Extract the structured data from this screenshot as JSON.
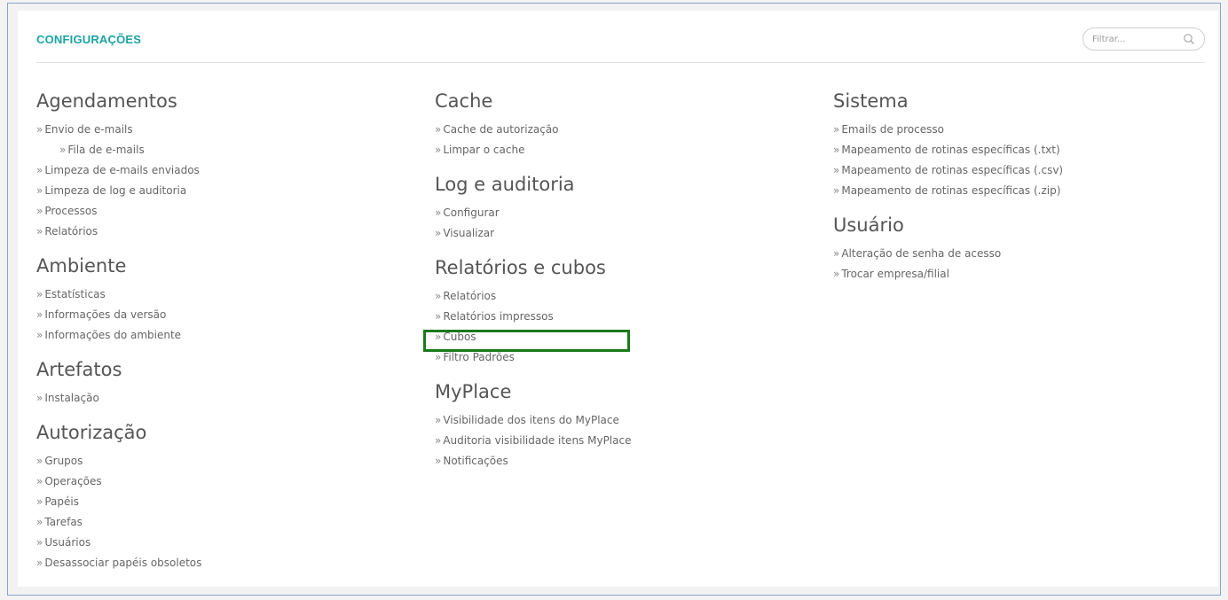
{
  "header": {
    "title": "CONFIGURAÇÕES",
    "filter_placeholder": "Filtrar...",
    "filter_value": ""
  },
  "chevron": "»",
  "columns": [
    {
      "sections": [
        {
          "title": "Agendamentos",
          "links": [
            {
              "label": "Envio de e-mails",
              "indent": false
            },
            {
              "label": "Fila de e-mails",
              "indent": true
            },
            {
              "label": "Limpeza de e-mails enviados",
              "indent": false
            },
            {
              "label": "Limpeza de log e auditoria",
              "indent": false
            },
            {
              "label": "Processos",
              "indent": false
            },
            {
              "label": "Relatórios",
              "indent": false
            }
          ]
        },
        {
          "title": "Ambiente",
          "links": [
            {
              "label": "Estatísticas",
              "indent": false
            },
            {
              "label": "Informações da versão",
              "indent": false
            },
            {
              "label": "Informações do ambiente",
              "indent": false
            }
          ]
        },
        {
          "title": "Artefatos",
          "links": [
            {
              "label": "Instalação",
              "indent": false
            }
          ]
        },
        {
          "title": "Autorização",
          "links": [
            {
              "label": "Grupos",
              "indent": false
            },
            {
              "label": "Operações",
              "indent": false
            },
            {
              "label": "Papéis",
              "indent": false
            },
            {
              "label": "Tarefas",
              "indent": false
            },
            {
              "label": "Usuários",
              "indent": false
            },
            {
              "label": "Desassociar papéis obsoletos",
              "indent": false
            }
          ]
        }
      ]
    },
    {
      "sections": [
        {
          "title": "Cache",
          "links": [
            {
              "label": "Cache de autorização",
              "indent": false
            },
            {
              "label": "Limpar o cache",
              "indent": false
            }
          ]
        },
        {
          "title": "Log e auditoria",
          "links": [
            {
              "label": "Configurar",
              "indent": false
            },
            {
              "label": "Visualizar",
              "indent": false
            }
          ]
        },
        {
          "title": "Relatórios e cubos",
          "links": [
            {
              "label": "Relatórios",
              "indent": false
            },
            {
              "label": "Relatórios impressos",
              "indent": false
            },
            {
              "label": "Cubos",
              "indent": false
            },
            {
              "label": "Filtro Padrões",
              "indent": false
            }
          ]
        },
        {
          "title": "MyPlace",
          "links": [
            {
              "label": "Visibilidade dos itens do MyPlace",
              "indent": false
            },
            {
              "label": "Auditoria visibilidade itens MyPlace",
              "indent": false
            },
            {
              "label": "Notificações",
              "indent": false
            }
          ]
        }
      ]
    },
    {
      "sections": [
        {
          "title": "Sistema",
          "links": [
            {
              "label": "Emails de processo",
              "indent": false
            },
            {
              "label": "Mapeamento de rotinas específicas (.txt)",
              "indent": false
            },
            {
              "label": "Mapeamento de rotinas específicas (.csv)",
              "indent": false
            },
            {
              "label": "Mapeamento de rotinas específicas (.zip)",
              "indent": false
            }
          ]
        },
        {
          "title": "Usuário",
          "links": [
            {
              "label": "Alteração de senha de acesso",
              "indent": false
            },
            {
              "label": "Trocar empresa/filial",
              "indent": false
            }
          ]
        }
      ]
    }
  ],
  "colors": {
    "accent": "#1aa3a3",
    "highlight": "#1a7a1a"
  }
}
